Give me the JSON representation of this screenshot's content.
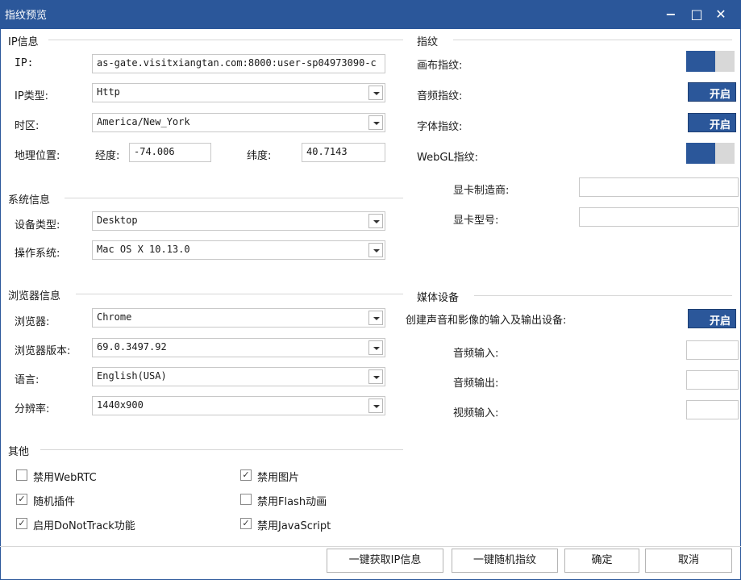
{
  "window": {
    "title": "指纹预览",
    "minimize": "−",
    "maximize": "□",
    "close": "✕"
  },
  "ip_info": {
    "group_title": "IP信息",
    "ip_label": "IP:",
    "ip_value": "as-gate.visitxiangtan.com:8000:user-sp04973090-c",
    "ip_type_label": "IP类型:",
    "ip_type_value": "Http",
    "timezone_label": "时区:",
    "timezone_value": "America/New_York",
    "geo_label": "地理位置:",
    "longitude_label": "经度:",
    "longitude_value": "-74.006",
    "latitude_label": "纬度:",
    "latitude_value": "40.7143"
  },
  "system_info": {
    "group_title": "系统信息",
    "device_type_label": "设备类型:",
    "device_type_value": "Desktop",
    "os_label": "操作系统:",
    "os_value": "Mac OS X 10.13.0"
  },
  "browser_info": {
    "group_title": "浏览器信息",
    "browser_label": "浏览器:",
    "browser_value": "Chrome",
    "version_label": "浏览器版本:",
    "version_value": "69.0.3497.92",
    "language_label": "语言:",
    "language_value": "English(USA)",
    "resolution_label": "分辨率:",
    "resolution_value": "1440x900"
  },
  "fingerprint": {
    "group_title": "指纹",
    "canvas_label": "画布指纹:",
    "audio_label": "音频指纹:",
    "audio_button": "开启",
    "font_label": "字体指纹:",
    "font_button": "开启",
    "webgl_label": "WebGL指纹:",
    "gpu_vendor_label": "显卡制造商:",
    "gpu_vendor_value": "",
    "gpu_model_label": "显卡型号:",
    "gpu_model_value": ""
  },
  "media": {
    "group_title": "媒体设备",
    "create_label": "创建声音和影像的输入及输出设备:",
    "create_button": "开启",
    "audio_in_label": "音频输入:",
    "audio_in_value": "",
    "audio_out_label": "音频输出:",
    "audio_out_value": "",
    "video_in_label": "视频输入:",
    "video_in_value": ""
  },
  "other": {
    "group_title": "其他",
    "options": [
      {
        "label": "禁用WebRTC",
        "checked": false
      },
      {
        "label": "禁用图片",
        "checked": true
      },
      {
        "label": "随机插件",
        "checked": true
      },
      {
        "label": "禁用Flash动画",
        "checked": false
      },
      {
        "label": "启用DoNotTrack功能",
        "checked": true
      },
      {
        "label": "禁用JavaScript",
        "checked": true
      }
    ],
    "check_mark": "✓"
  },
  "footer": {
    "get_ip_button": "一键获取IP信息",
    "random_button": "一键随机指纹",
    "ok_button": "确定",
    "cancel_button": "取消"
  },
  "colors": {
    "accent": "#2b579a"
  }
}
